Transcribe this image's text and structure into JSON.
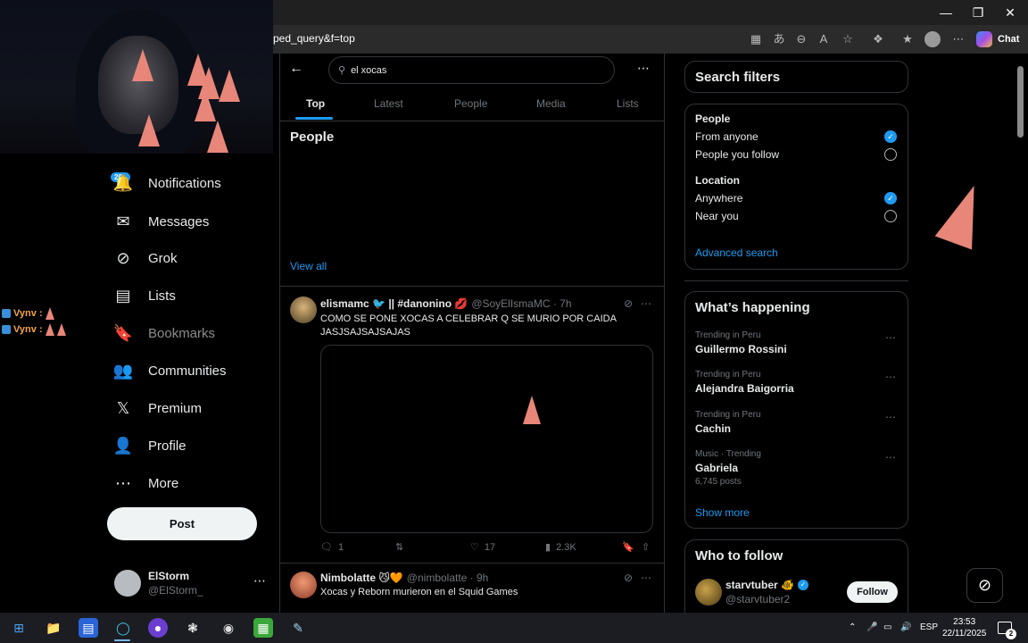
{
  "browser": {
    "address": "yped_query&f=top",
    "chat_label": "Chat",
    "win_minimize": "—",
    "win_restore": "❐",
    "win_close": "✕"
  },
  "stream_chat": [
    {
      "user": "Vynv :"
    },
    {
      "user": "Vynv :"
    }
  ],
  "nav": {
    "notif_badge": "20+",
    "items": [
      {
        "label": "Notifications"
      },
      {
        "label": "Messages"
      },
      {
        "label": "Grok"
      },
      {
        "label": "Lists"
      },
      {
        "label": "Bookmarks"
      },
      {
        "label": "Communities"
      },
      {
        "label": "Premium"
      },
      {
        "label": "Profile"
      },
      {
        "label": "More"
      }
    ],
    "post_label": "Post",
    "account": {
      "name": "ElStorm",
      "handle": "@ElStorm_"
    }
  },
  "search": {
    "query": "el xocas"
  },
  "tabs": [
    "Top",
    "Latest",
    "People",
    "Media",
    "Lists"
  ],
  "people_section": {
    "title": "People",
    "view_all": "View all"
  },
  "tweets": [
    {
      "name": "elismamc 🐦 || #danonino 💋",
      "handle": "@SoyElIsmaMC · 7h",
      "text": "COMO SE PONE XOCAS A CELEBRAR Q SE MURIO POR CAIDA JASJSAJSAJSAJAS",
      "replies": "1",
      "retweets": "",
      "likes": "17",
      "views": "2.3K"
    },
    {
      "name": "Nimbolatte 😼🧡",
      "handle": "@nimbolatte · 9h",
      "text": "Xocas y Reborn murieron en el Squid Games"
    }
  ],
  "filters": {
    "title": "Search filters",
    "people_label": "People",
    "from_anyone": "From anyone",
    "people_you_follow": "People you follow",
    "location_label": "Location",
    "anywhere": "Anywhere",
    "near_you": "Near you",
    "advanced": "Advanced search"
  },
  "happening": {
    "title": "What’s happening",
    "trends": [
      {
        "category": "Trending in Peru",
        "name": "Guillermo Rossini",
        "count": ""
      },
      {
        "category": "Trending in Peru",
        "name": "Alejandra Baigorria",
        "count": ""
      },
      {
        "category": "Trending in Peru",
        "name": "Cachin",
        "count": ""
      },
      {
        "category": "Music · Trending",
        "name": "Gabriela",
        "count": "6,745 posts"
      }
    ],
    "show_more": "Show more"
  },
  "who_to_follow": {
    "title": "Who to follow",
    "name": "starvtuber 🐠",
    "handle": "@starvtuber2",
    "follow_label": "Follow"
  },
  "taskbar": {
    "lang": "ESP",
    "time": "23:53",
    "date": "22/11/2025",
    "notif_count": "2"
  },
  "colors": {
    "accent": "#1d9bf0",
    "background": "#000000",
    "text": "#e7e9ea",
    "muted": "#71767b"
  }
}
